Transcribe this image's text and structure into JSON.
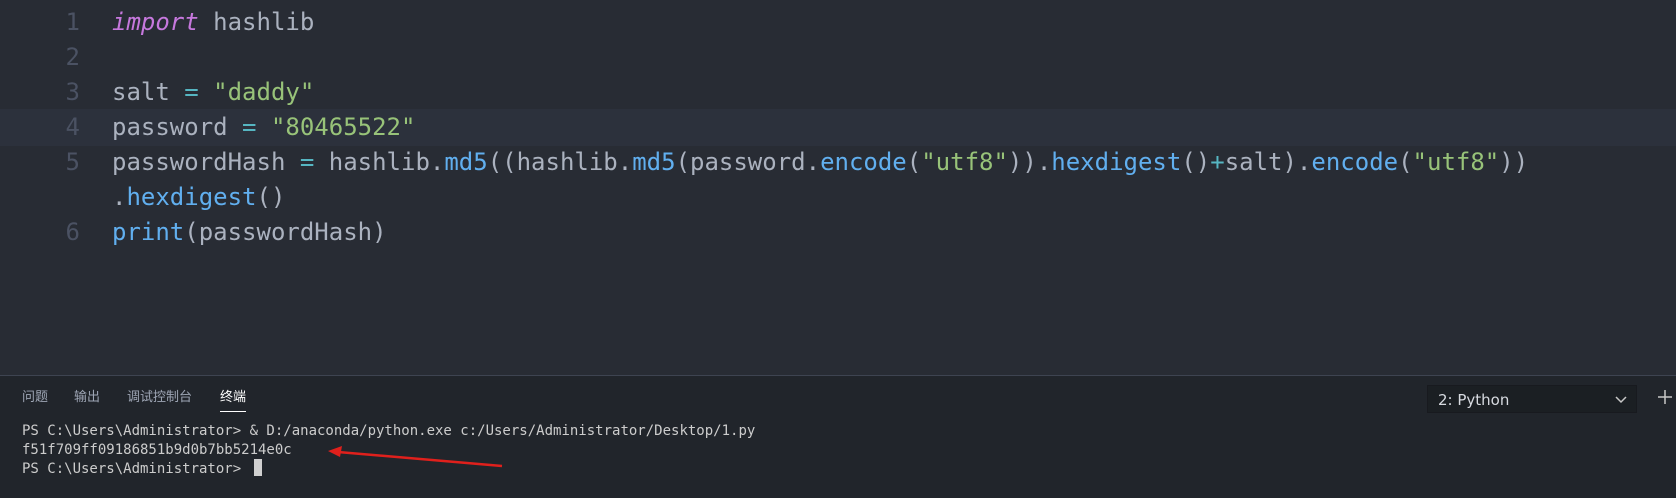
{
  "editor": {
    "lines": [
      {
        "num": "1",
        "tokens": [
          "import",
          " hashlib"
        ]
      },
      {
        "num": "2",
        "tokens": []
      },
      {
        "num": "3",
        "tokens": [
          "salt",
          " = ",
          "\"daddy\""
        ]
      },
      {
        "num": "4",
        "tokens": [
          "password",
          " = ",
          "\"80465522\""
        ]
      },
      {
        "num": "5",
        "tokens": [
          "passwordHash",
          " = ",
          "hashlib.",
          "md5",
          "((hashlib.",
          "md5",
          "(password.",
          "encode",
          "(",
          "\"utf8\"",
          ")).",
          "hexdigest",
          "()",
          "+",
          "salt).",
          "encode",
          "(",
          "\"utf8\"",
          "))"
        ]
      },
      {
        "num": "",
        "tokens": [
          ".",
          "hexdigest",
          "()"
        ]
      },
      {
        "num": "6",
        "tokens": [
          "print",
          "(passwordHash)"
        ]
      }
    ]
  },
  "panel": {
    "tabs": [
      "问题",
      "输出",
      "调试控制台",
      "终端"
    ],
    "active_tab": "终端",
    "terminal_select": "2: Python",
    "terminal_lines": [
      "PS C:\\Users\\Administrator> & D:/anaconda/python.exe c:/Users/Administrator/Desktop/1.py",
      "f51f709ff09186851b9d0b7bb5214e0c",
      "PS C:\\Users\\Administrator> "
    ]
  },
  "colors": {
    "keyword": "#c678dd",
    "string": "#98c379",
    "operator": "#56b6c2",
    "function": "#61afef",
    "annotation_arrow": "#e0201c"
  },
  "icons": {
    "select_chevron": "chevron-down-icon",
    "new_terminal": "plus-icon",
    "annotation": "red-arrow"
  }
}
